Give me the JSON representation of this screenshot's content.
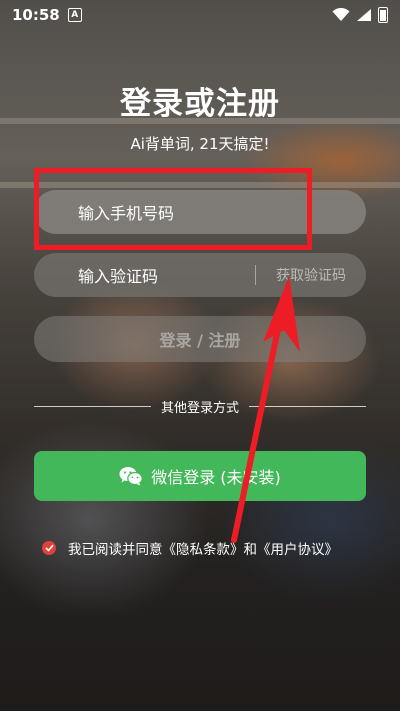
{
  "status_bar": {
    "time": "10:58",
    "app_icon": "A",
    "icons": [
      "wifi-icon",
      "signal-icon",
      "battery-icon"
    ]
  },
  "title": "登录或注册",
  "subtitle": "Ai背单词, 21天搞定!",
  "phone_input": {
    "placeholder": "输入手机号码"
  },
  "code_input": {
    "placeholder": "输入验证码",
    "get_code_label": "获取验证码"
  },
  "login_button": "登录 / 注册",
  "other_methods_label": "其他登录方式",
  "wechat_button": {
    "label": "微信登录 (未安装)",
    "color": "#43b85a"
  },
  "agreement": {
    "prefix": "我已阅读并同意",
    "privacy_link": "《隐私条款》",
    "conjunction": "和",
    "terms_link": "《用户协议》",
    "checked": true
  },
  "annotation_color": "#ee1c25"
}
